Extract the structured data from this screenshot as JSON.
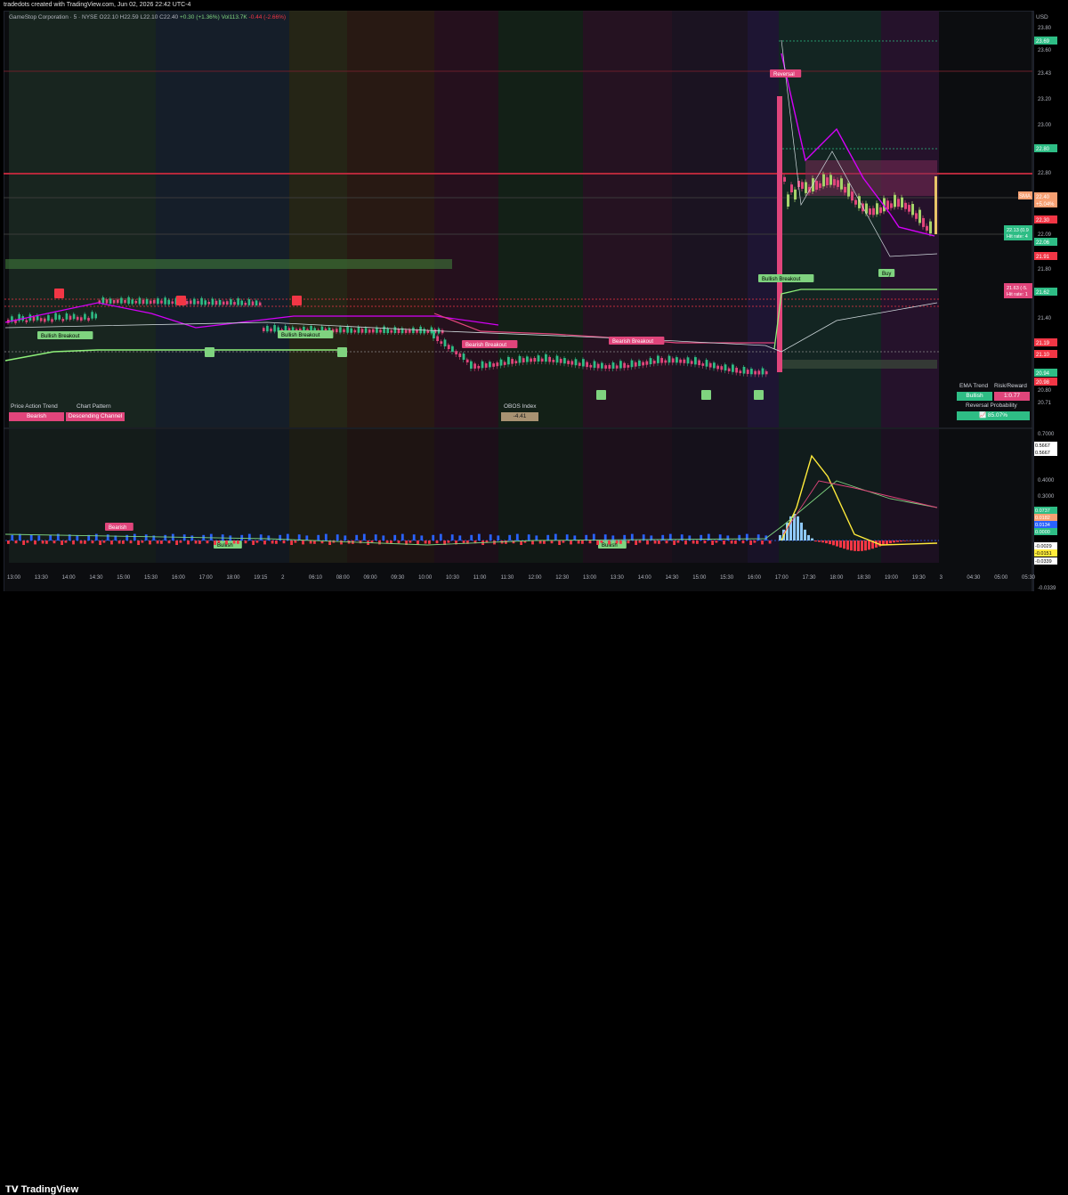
{
  "header": {
    "created_by": "tradedots created with TradingView.com, Jun 02, 2026 22:42 UTC-4",
    "currency": "USD"
  },
  "legend": {
    "symbol": "GameStop Corporation · 5 · NYSE",
    "open": "O22.10",
    "high": "H22.59",
    "low": "L22.10",
    "close": "C22.40",
    "change": "+0.30 (+1.36%)",
    "volume": "Vol113.7K",
    "volume_change": "-0.44 (-2.66%)"
  },
  "chart_data": {
    "type": "candlestick",
    "price_axis": {
      "ticks": [
        "23.80",
        "23.60",
        "23.43",
        "23.20",
        "23.00",
        "22.80",
        "22.09",
        "21.80",
        "21.40",
        "20.80",
        "20.71"
      ],
      "labels": [
        {
          "text": "23.69",
          "color": "#2ebd85"
        },
        {
          "text": "22.80",
          "color": "#2ebd85"
        },
        {
          "text": "22.40",
          "color": "#f7a072"
        },
        {
          "text": "+5.04%",
          "color": "#f7a072"
        },
        {
          "text": "22.30",
          "color": "#f23645"
        },
        {
          "text": "22.06",
          "color": "#2ebd85"
        },
        {
          "text": "21.91",
          "color": "#f23645"
        },
        {
          "text": "21.62",
          "color": "#2ebd85"
        },
        {
          "text": "21.19",
          "color": "#f23645"
        },
        {
          "text": "21.10",
          "color": "#f23645"
        },
        {
          "text": "20.94",
          "color": "#2ebd85"
        },
        {
          "text": "20.98",
          "color": "#f23645"
        }
      ]
    },
    "oscillator_axis": {
      "ticks": [
        "0.7000",
        "0.4000",
        "0.3000",
        "0.2000",
        "-0.0339"
      ],
      "labels": [
        {
          "text": "0.5667",
          "color": "#ffffff"
        },
        {
          "text": "0.5667",
          "color": "#ffffff"
        },
        {
          "text": "0.0737",
          "color": "#2ebd85"
        },
        {
          "text": "0.0182",
          "color": "#f7a072"
        },
        {
          "text": "0.0134",
          "color": "#2962ff"
        },
        {
          "text": "0.0000",
          "color": "#2ebd85"
        },
        {
          "text": "-0.0029",
          "color": "#ffffff"
        },
        {
          "text": "-0.0151",
          "color": "#ffeb3b"
        },
        {
          "text": "-0.0339",
          "color": "#ffffff"
        }
      ]
    },
    "time_axis": [
      "13:00",
      "13:30",
      "14:00",
      "14:30",
      "15:00",
      "15:30",
      "16:00",
      "17:00",
      "18:00",
      "19:15",
      "2",
      "06:10",
      "08:00",
      "09:00",
      "09:30",
      "10:00",
      "10:30",
      "11:00",
      "11:30",
      "12:00",
      "12:30",
      "13:00",
      "13:30",
      "14:00",
      "14:30",
      "15:00",
      "15:30",
      "16:00",
      "17:00",
      "17:30",
      "18:00",
      "18:30",
      "19:00",
      "19:30",
      "3",
      "04:30",
      "05:00",
      "05:30"
    ],
    "pattern_labels": [
      "Bullish Breakout",
      "Bullish Breakout",
      "Bearish Breakout",
      "Bearish Breakout",
      "Bullish Breakout",
      "Reversal",
      "Bearish",
      "Bullish",
      "Bullish",
      "Buy"
    ],
    "price_target_boxes": [
      {
        "line1": "22.13 (0.9",
        "line2": "Hit rate: 4"
      },
      {
        "line1": "21.63 (-5.",
        "line2": "Hit rate: 1"
      }
    ],
    "sma_label": "SMA"
  },
  "panels": {
    "trend": {
      "price_action_header": "Price Action Trend",
      "pattern_header": "Chart Pattern",
      "price_action_value": "Bearish",
      "pattern_value": "Descending Channel"
    },
    "obos": {
      "header": "OBOS Index",
      "value": "-4.41"
    },
    "ema": {
      "ema_header": "EMA Trend",
      "rr_header": "Risk/Reward",
      "ema_value": "Bullish",
      "rr_value": "1:0.77",
      "rev_header": "Reversal Probability",
      "rev_value": "85.07%"
    }
  },
  "branding": {
    "logo": "TradingView"
  },
  "colors": {
    "bull": "#2ebd85",
    "bear": "#f23645",
    "magenta": "#d500f9",
    "yellow": "#ffeb3b"
  }
}
